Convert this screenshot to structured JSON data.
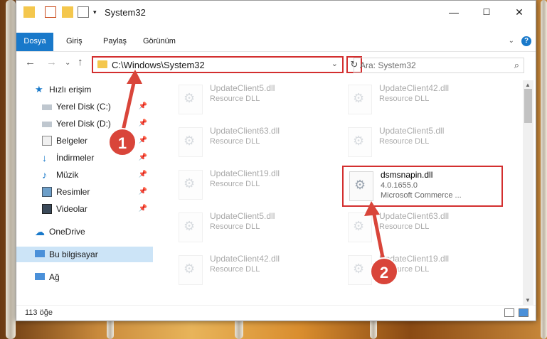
{
  "window": {
    "title": "System32",
    "controls": {
      "minimize": "—",
      "maximize": "☐",
      "close": "✕"
    }
  },
  "ribbon": {
    "tabs": [
      {
        "label": "Dosya"
      },
      {
        "label": "Giriş"
      },
      {
        "label": "Paylaş"
      },
      {
        "label": "Görünüm"
      }
    ],
    "help": "?"
  },
  "nav": {
    "address_path": "C:\\Windows\\System32",
    "search_placeholder": "Ara: System32"
  },
  "sidebar": {
    "items": [
      {
        "label": "Hızlı erişim",
        "icon": "star-icon",
        "pinned": false
      },
      {
        "label": "Yerel Disk (C:)",
        "icon": "drive-icon",
        "pinned": true
      },
      {
        "label": "Yerel Disk (D:)",
        "icon": "drive-icon",
        "pinned": true
      },
      {
        "label": "Belgeler",
        "icon": "documents-icon",
        "pinned": true
      },
      {
        "label": "İndirmeler",
        "icon": "download-icon",
        "pinned": true
      },
      {
        "label": "Müzik",
        "icon": "music-icon",
        "pinned": true
      },
      {
        "label": "Resimler",
        "icon": "pictures-icon",
        "pinned": true
      },
      {
        "label": "Videolar",
        "icon": "videos-icon",
        "pinned": true
      },
      {
        "label": "OneDrive",
        "icon": "cloud-icon",
        "pinned": false
      },
      {
        "label": "Bu bilgisayar",
        "icon": "computer-icon",
        "pinned": false,
        "selected": true
      },
      {
        "label": "Ağ",
        "icon": "network-icon",
        "pinned": false
      }
    ]
  },
  "files": [
    {
      "name": "UpdateClient5.dll",
      "type": "Resource DLL"
    },
    {
      "name": "UpdateClient42.dll",
      "type": "Resource DLL"
    },
    {
      "name": "UpdateClient63.dll",
      "type": "Resource DLL"
    },
    {
      "name": "UpdateClient5.dll",
      "type": "Resource DLL"
    },
    {
      "name": "UpdateClient19.dll",
      "type": "Resource DLL"
    },
    {
      "name": "dsmsnapin.dll",
      "type": "4.0.1655.0",
      "extra": "Microsoft Commerce ..."
    },
    {
      "name": "UpdateClient5.dll",
      "type": "Resource DLL"
    },
    {
      "name": "UpdateClient63.dll",
      "type": "Resource DLL"
    },
    {
      "name": "UpdateClient42.dll",
      "type": "Resource DLL"
    },
    {
      "name": "UpdateClient19.dll",
      "type": "Resource DLL"
    }
  ],
  "status": {
    "count": "113 öğe"
  },
  "callouts": [
    "1",
    "2"
  ],
  "colors": {
    "accent": "#1979ca",
    "highlight": "#d32f2f",
    "callout": "#d9453a"
  }
}
